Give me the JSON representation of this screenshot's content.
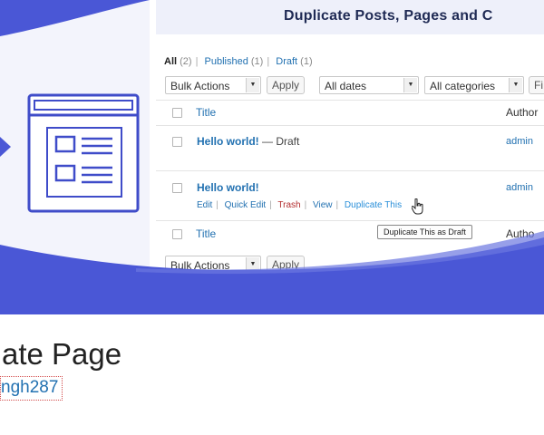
{
  "banner": {
    "mock_title": "Duplicate Posts, Pages and C",
    "filters": [
      {
        "label": "All",
        "count": "(2)",
        "current": true
      },
      {
        "label": "Published",
        "count": "(1)",
        "current": false
      },
      {
        "label": "Draft",
        "count": "(1)",
        "current": false
      }
    ],
    "bulk_actions": "Bulk Actions",
    "apply": "Apply",
    "all_dates": "All dates",
    "all_categories": "All categories",
    "filter_button": "Fi",
    "table": {
      "col_title": "Title",
      "col_author": "Author",
      "rows": [
        {
          "title": "Hello world!",
          "state": " — Draft",
          "author": "admin"
        },
        {
          "title": "Hello world!",
          "state": "",
          "author": "admin"
        }
      ],
      "footer_title": "Title",
      "footer_author": "Autho"
    },
    "row_actions": {
      "edit": "Edit",
      "quick_edit": "Quick Edit",
      "trash": "Trash",
      "view": "View",
      "duplicate": "Duplicate This"
    },
    "tooltip": "Duplicate This as Draft",
    "bottom_bulk": "Bulk Actions",
    "bottom_apply": "Apply"
  },
  "plugin": {
    "name": "ate Page",
    "author": "ngh287"
  },
  "colors": {
    "brand_blue": "#4a57d6",
    "link_blue": "#2271b1",
    "trash_red": "#b32d2e"
  }
}
